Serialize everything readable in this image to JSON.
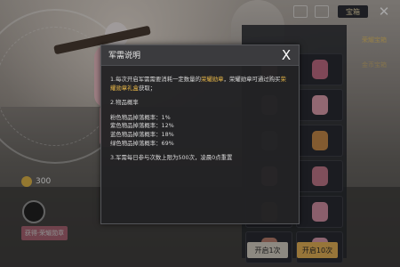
{
  "dialog": {
    "title": "军需说明",
    "close_glyph": "X",
    "rule1_a": "1.每次开启军需需要消耗一定数量的",
    "rule1_highlight_a": "荣耀勋章",
    "rule1_b": "，荣耀勋章可通过购买",
    "rule1_highlight_b": "荣耀勋章礼盒",
    "rule1_c": "获取；",
    "rule2_title": "2.物品概率",
    "rates": [
      "粉色物品掉落概率：1%",
      "紫色物品掉落概率：12%",
      "蓝色物品掉落概率：18%",
      "绿色物品掉落概率：69%"
    ],
    "rule3": "3.军需每日参与次数上限为500次，凌晨0点重置"
  },
  "background": {
    "treasure_label": "宝箱",
    "close_glyph": "✕",
    "coin_amount": "300",
    "nav_items": [
      "荣耀宝箱",
      "金币宝箱"
    ],
    "bottom_left": "开启1次",
    "bottom_right": "开启10次",
    "pink_tag": "获得·荣耀勋章"
  },
  "colors": {
    "highlight": "#e7b648",
    "dialog_bg": "#222224",
    "accent_gold": "#e9b458"
  },
  "icons": {
    "dialog_close": "close-icon",
    "coin": "coin-icon"
  }
}
